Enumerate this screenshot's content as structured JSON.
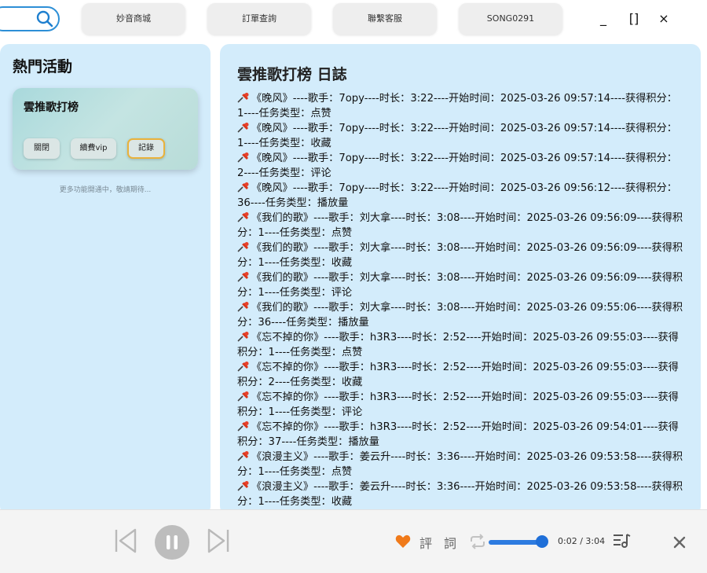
{
  "header": {
    "nav": [
      "妙音商城",
      "訂單查詢",
      "聯繫客服",
      "SONG0291"
    ],
    "window_controls": [
      "_",
      "[]",
      "×"
    ]
  },
  "sidebar": {
    "title": "熱門活動",
    "card": {
      "title": "雲推歌打榜",
      "buttons": [
        "關閉",
        "續費vip",
        "記錄"
      ],
      "active_button": "記錄"
    },
    "note": "更多功能開通中，敬請期待..."
  },
  "main": {
    "title": "雲推歌打榜 日誌",
    "entries": [
      "《晚风》----歌手：7opy----时长：3:22----开始时间：2025-03-26 09:57:14----获得积分：1----任务类型：点赞",
      "《晚风》----歌手：7opy----时长：3:22----开始时间：2025-03-26 09:57:14----获得积分：1----任务类型：收藏",
      "《晚风》----歌手：7opy----时长：3:22----开始时间：2025-03-26 09:57:14----获得积分：2----任务类型：评论",
      "《晚风》----歌手：7opy----时长：3:22----开始时间：2025-03-26 09:56:12----获得积分：36----任务类型：播放量",
      "《我们的歌》----歌手：刘大拿----时长：3:08----开始时间：2025-03-26 09:56:09----获得积分：1----任务类型：点赞",
      "《我们的歌》----歌手：刘大拿----时长：3:08----开始时间：2025-03-26 09:56:09----获得积分：1----任务类型：收藏",
      "《我们的歌》----歌手：刘大拿----时长：3:08----开始时间：2025-03-26 09:56:09----获得积分：1----任务类型：评论",
      "《我们的歌》----歌手：刘大拿----时长：3:08----开始时间：2025-03-26 09:55:06----获得积分：36----任务类型：播放量",
      "《忘不掉的你》----歌手：h3R3----时长：2:52----开始时间：2025-03-26 09:55:03----获得积分：1----任务类型：点赞",
      "《忘不掉的你》----歌手：h3R3----时长：2:52----开始时间：2025-03-26 09:55:03----获得积分：2----任务类型：收藏",
      "《忘不掉的你》----歌手：h3R3----时长：2:52----开始时间：2025-03-26 09:55:03----获得积分：1----任务类型：评论",
      "《忘不掉的你》----歌手：h3R3----时长：2:52----开始时间：2025-03-26 09:54:01----获得积分：37----任务类型：播放量",
      "《浪漫主义》----歌手：姜云升----时长：3:36----开始时间：2025-03-26 09:53:58----获得积分：1----任务类型：点赞",
      "《浪漫主义》----歌手：姜云升----时长：3:36----开始时间：2025-03-26 09:53:58----获得积分：1----任务类型：收藏"
    ]
  },
  "player": {
    "comment_label": "評",
    "lyrics_label": "詞",
    "time": "0:02 / 3:04",
    "progress_fraction": 0.011,
    "icons": [
      "prev-icon",
      "pause-icon",
      "next-icon",
      "heart-icon",
      "repeat-icon",
      "playlist-icon",
      "close-icon"
    ],
    "colors": {
      "accent": "#2d7be0",
      "heart": "#f07a1a"
    }
  }
}
